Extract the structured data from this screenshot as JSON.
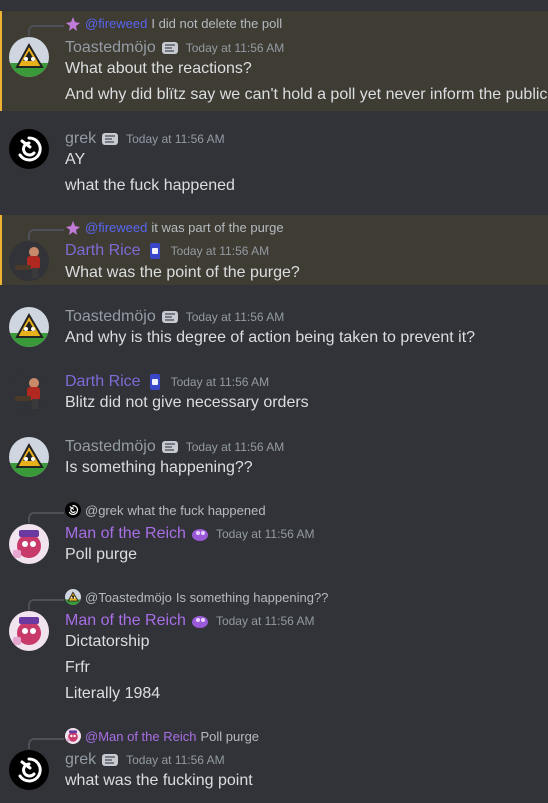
{
  "colors": {
    "background": "#313338",
    "highlight": "#3f3c33",
    "darth_rice": "#7e6bd6",
    "man_reich": "#a86ee6",
    "fireweed": "#5865f2"
  },
  "messages": [
    {
      "reply": {
        "mention": "@fireweed",
        "text": "I did not delete the poll"
      },
      "author": "Toastedmöjo",
      "time": "Today at 11:56 AM",
      "lines": [
        "What about the reactions?",
        "And why did blïtz say we can't hold a poll yet never inform the public"
      ]
    },
    {
      "author": "grek",
      "time": "Today at 11:56 AM",
      "lines": [
        "AY",
        "what the fuck happened"
      ]
    },
    {
      "reply": {
        "mention": "@fireweed",
        "text": "it was part of the purge"
      },
      "author": "Darth Rice",
      "time": "Today at 11:56 AM",
      "lines": [
        "What was the point of the purge?"
      ]
    },
    {
      "author": "Toastedmöjo",
      "time": "Today at 11:56 AM",
      "lines": [
        "And why is this degree of action being taken to prevent it?"
      ]
    },
    {
      "author": "Darth Rice",
      "time": "Today at 11:56 AM",
      "lines": [
        "Blitz did not give necessary orders"
      ]
    },
    {
      "author": "Toastedmöjo",
      "time": "Today at 11:56 AM",
      "lines": [
        "Is something happening??"
      ]
    },
    {
      "reply": {
        "mention": "@grek",
        "text": "what the fuck happened"
      },
      "author": "Man of the Reich",
      "time": "Today at 11:56 AM",
      "lines": [
        "Poll purge"
      ]
    },
    {
      "reply": {
        "mention": "@Toastedmöjo",
        "text": "Is something happening??"
      },
      "author": "Man of the Reich",
      "time": "Today at 11:56 AM",
      "lines": [
        "Dictatorship",
        "Frfr",
        "Literally 1984"
      ]
    },
    {
      "reply": {
        "mention": "@Man of the Reich",
        "text": "Poll purge"
      },
      "author": "grek",
      "time": "Today at 11:56 AM",
      "lines": [
        "what was the fucking point"
      ]
    }
  ]
}
